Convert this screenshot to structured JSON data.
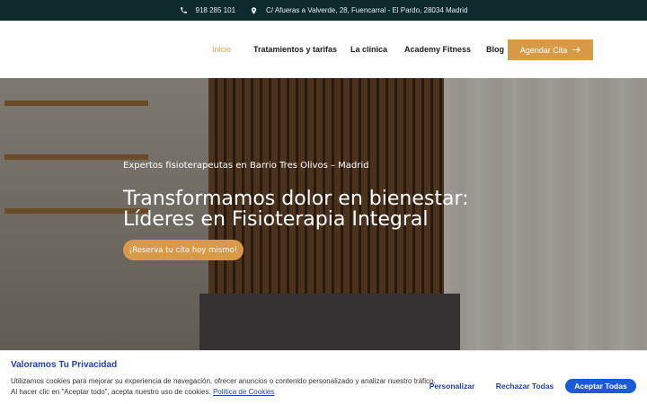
{
  "topbar": {
    "phone": "918 285 101",
    "address": "C/ Afueras a Valverde, 28, Fuencarral - El Pardo, 28034 Madrid",
    "phone_icon": "phone-icon",
    "location_icon": "location-pin-icon"
  },
  "nav": {
    "items": [
      {
        "label": "Inicio",
        "active": true
      },
      {
        "label": "Tratamientos y tarifas"
      },
      {
        "label": "La clínica"
      },
      {
        "label": "Academy Fitness"
      },
      {
        "label": "Blog"
      }
    ],
    "cta_label": "Agendar Cita",
    "cta_icon": "arrow-right-icon"
  },
  "hero": {
    "eyebrow": "Expertos fisioterapeutas en Barrio Tres Olivos – Madrid",
    "title_line1": "Transformamos dolor en bienestar:",
    "title_line2": "Líderes en Fisioterapia Integral",
    "button_label": "¡Reserva tu cita hoy mismo!"
  },
  "cookie": {
    "title": "Valoramos Tu Privacidad",
    "text1": "Utilizamos cookies para mejorar su experiencia de navegación, ofrecer anuncios o contenido personalizado y analizar nuestro tráfico.",
    "text2": "Al hacer clic en \"Aceptar todo\", acepta nuestro uso de cookies.",
    "policy_link": "Política de Cookies",
    "customize": "Personalizar",
    "reject": "Rechazar Todas",
    "accept": "Aceptar Todas"
  },
  "colors": {
    "topbar_bg": "#0e2a2c",
    "accent": "#d99a48",
    "cookie_blue": "#1f3fae"
  }
}
